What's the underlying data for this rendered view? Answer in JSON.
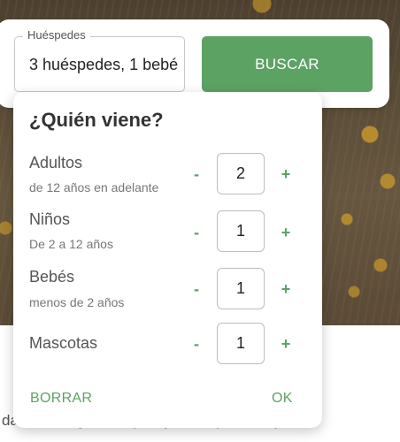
{
  "search": {
    "guests_label": "Huéspedes",
    "guests_value": "3 huéspedes, 1 bebé",
    "search_button": "BUSCAR"
  },
  "popover": {
    "title": "¿Quién viene?",
    "rows": [
      {
        "label": "Adultos",
        "sub": "de 12 años en adelante",
        "count": "2",
        "minus": "-",
        "plus": "+"
      },
      {
        "label": "Niños",
        "sub": "De 2 a 12 años",
        "count": "1",
        "minus": "-",
        "plus": "+"
      },
      {
        "label": "Bebés",
        "sub": "menos de 2 años",
        "count": "1",
        "minus": "-",
        "plus": "+"
      },
      {
        "label": "Mascotas",
        "sub": "",
        "count": "1",
        "minus": "-",
        "plus": "+"
      }
    ],
    "clear_button": "BORRAR",
    "ok_button": "OK"
  },
  "background": {
    "description_text": "da de un lugar tranquilo y único para relajarte"
  },
  "colors": {
    "accent": "#5ca263",
    "text": "#333333"
  }
}
